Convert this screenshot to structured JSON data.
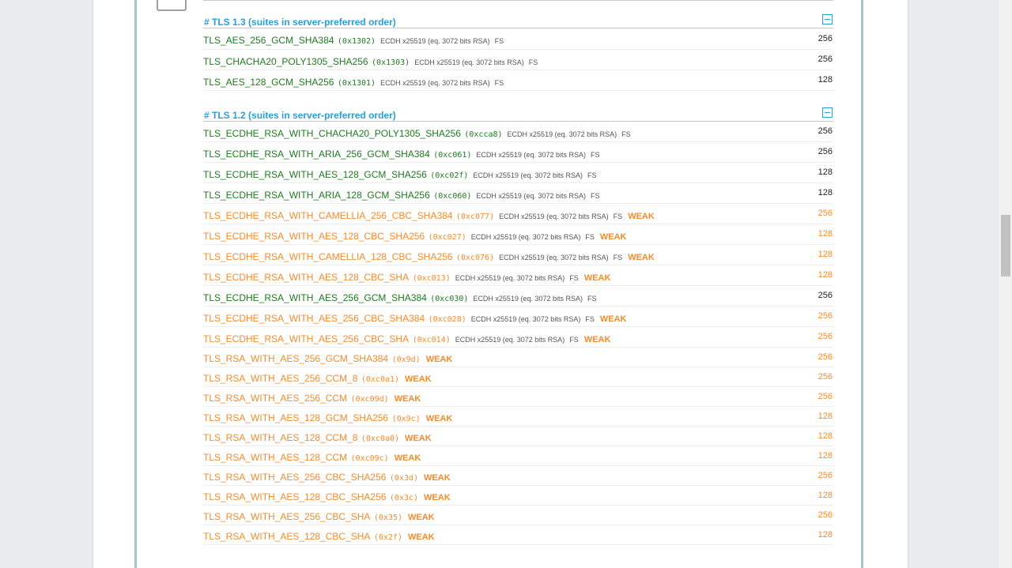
{
  "sections": [
    {
      "header": "# TLS 1.3 (suites in server-preferred order)",
      "rows": [
        {
          "name": "TLS_AES_256_GCM_SHA384",
          "code": "(0x1302)",
          "kex": "ECDH x25519 (eq. 3072 bits RSA)",
          "fs": "FS",
          "weak": "",
          "bits": "256",
          "status": "green"
        },
        {
          "name": "TLS_CHACHA20_POLY1305_SHA256",
          "code": "(0x1303)",
          "kex": "ECDH x25519 (eq. 3072 bits RSA)",
          "fs": "FS",
          "weak": "",
          "bits": "256",
          "status": "green"
        },
        {
          "name": "TLS_AES_128_GCM_SHA256",
          "code": "(0x1301)",
          "kex": "ECDH x25519 (eq. 3072 bits RSA)",
          "fs": "FS",
          "weak": "",
          "bits": "128",
          "status": "green"
        }
      ]
    },
    {
      "header": "# TLS 1.2 (suites in server-preferred order)",
      "rows": [
        {
          "name": "TLS_ECDHE_RSA_WITH_CHACHA20_POLY1305_SHA256",
          "code": "(0xcca8)",
          "kex": "ECDH x25519 (eq. 3072 bits RSA)",
          "fs": "FS",
          "weak": "",
          "bits": "256",
          "status": "green"
        },
        {
          "name": "TLS_ECDHE_RSA_WITH_ARIA_256_GCM_SHA384",
          "code": "(0xc061)",
          "kex": "ECDH x25519 (eq. 3072 bits RSA)",
          "fs": "FS",
          "weak": "",
          "bits": "256",
          "status": "green"
        },
        {
          "name": "TLS_ECDHE_RSA_WITH_AES_128_GCM_SHA256",
          "code": "(0xc02f)",
          "kex": "ECDH x25519 (eq. 3072 bits RSA)",
          "fs": "FS",
          "weak": "",
          "bits": "128",
          "status": "green"
        },
        {
          "name": "TLS_ECDHE_RSA_WITH_ARIA_128_GCM_SHA256",
          "code": "(0xc060)",
          "kex": "ECDH x25519 (eq. 3072 bits RSA)",
          "fs": "FS",
          "weak": "",
          "bits": "128",
          "status": "green"
        },
        {
          "name": "TLS_ECDHE_RSA_WITH_CAMELLIA_256_CBC_SHA384",
          "code": "(0xc077)",
          "kex": "ECDH x25519 (eq. 3072 bits RSA)",
          "fs": "FS",
          "weak": "WEAK",
          "bits": "256",
          "status": "orange"
        },
        {
          "name": "TLS_ECDHE_RSA_WITH_AES_128_CBC_SHA256",
          "code": "(0xc027)",
          "kex": "ECDH x25519 (eq. 3072 bits RSA)",
          "fs": "FS",
          "weak": "WEAK",
          "bits": "128",
          "status": "orange"
        },
        {
          "name": "TLS_ECDHE_RSA_WITH_CAMELLIA_128_CBC_SHA256",
          "code": "(0xc076)",
          "kex": "ECDH x25519 (eq. 3072 bits RSA)",
          "fs": "FS",
          "weak": "WEAK",
          "bits": "128",
          "status": "orange"
        },
        {
          "name": "TLS_ECDHE_RSA_WITH_AES_128_CBC_SHA",
          "code": "(0xc013)",
          "kex": "ECDH x25519 (eq. 3072 bits RSA)",
          "fs": "FS",
          "weak": "WEAK",
          "bits": "128",
          "status": "orange"
        },
        {
          "name": "TLS_ECDHE_RSA_WITH_AES_256_GCM_SHA384",
          "code": "(0xc030)",
          "kex": "ECDH x25519 (eq. 3072 bits RSA)",
          "fs": "FS",
          "weak": "",
          "bits": "256",
          "status": "green"
        },
        {
          "name": "TLS_ECDHE_RSA_WITH_AES_256_CBC_SHA384",
          "code": "(0xc028)",
          "kex": "ECDH x25519 (eq. 3072 bits RSA)",
          "fs": "FS",
          "weak": "WEAK",
          "bits": "256",
          "status": "orange"
        },
        {
          "name": "TLS_ECDHE_RSA_WITH_AES_256_CBC_SHA",
          "code": "(0xc014)",
          "kex": "ECDH x25519 (eq. 3072 bits RSA)",
          "fs": "FS",
          "weak": "WEAK",
          "bits": "256",
          "status": "orange"
        },
        {
          "name": "TLS_RSA_WITH_AES_256_GCM_SHA384",
          "code": "(0x9d)",
          "kex": "",
          "fs": "",
          "weak": "WEAK",
          "bits": "256",
          "status": "orange"
        },
        {
          "name": "TLS_RSA_WITH_AES_256_CCM_8",
          "code": "(0xc0a1)",
          "kex": "",
          "fs": "",
          "weak": "WEAK",
          "bits": "256",
          "status": "orange"
        },
        {
          "name": "TLS_RSA_WITH_AES_256_CCM",
          "code": "(0xc09d)",
          "kex": "",
          "fs": "",
          "weak": "WEAK",
          "bits": "256",
          "status": "orange"
        },
        {
          "name": "TLS_RSA_WITH_AES_128_GCM_SHA256",
          "code": "(0x9c)",
          "kex": "",
          "fs": "",
          "weak": "WEAK",
          "bits": "128",
          "status": "orange"
        },
        {
          "name": "TLS_RSA_WITH_AES_128_CCM_8",
          "code": "(0xc0a0)",
          "kex": "",
          "fs": "",
          "weak": "WEAK",
          "bits": "128",
          "status": "orange"
        },
        {
          "name": "TLS_RSA_WITH_AES_128_CCM",
          "code": "(0xc09c)",
          "kex": "",
          "fs": "",
          "weak": "WEAK",
          "bits": "128",
          "status": "orange"
        },
        {
          "name": "TLS_RSA_WITH_AES_256_CBC_SHA256",
          "code": "(0x3d)",
          "kex": "",
          "fs": "",
          "weak": "WEAK",
          "bits": "256",
          "status": "orange"
        },
        {
          "name": "TLS_RSA_WITH_AES_128_CBC_SHA256",
          "code": "(0x3c)",
          "kex": "",
          "fs": "",
          "weak": "WEAK",
          "bits": "128",
          "status": "orange"
        },
        {
          "name": "TLS_RSA_WITH_AES_256_CBC_SHA",
          "code": "(0x35)",
          "kex": "",
          "fs": "",
          "weak": "WEAK",
          "bits": "256",
          "status": "orange"
        },
        {
          "name": "TLS_RSA_WITH_AES_128_CBC_SHA",
          "code": "(0x2f)",
          "kex": "",
          "fs": "",
          "weak": "WEAK",
          "bits": "128",
          "status": "orange"
        }
      ]
    }
  ],
  "colors": {
    "secure": "#1f7a1f",
    "weak": "#f58b2e",
    "header": "#2a9fd6"
  }
}
